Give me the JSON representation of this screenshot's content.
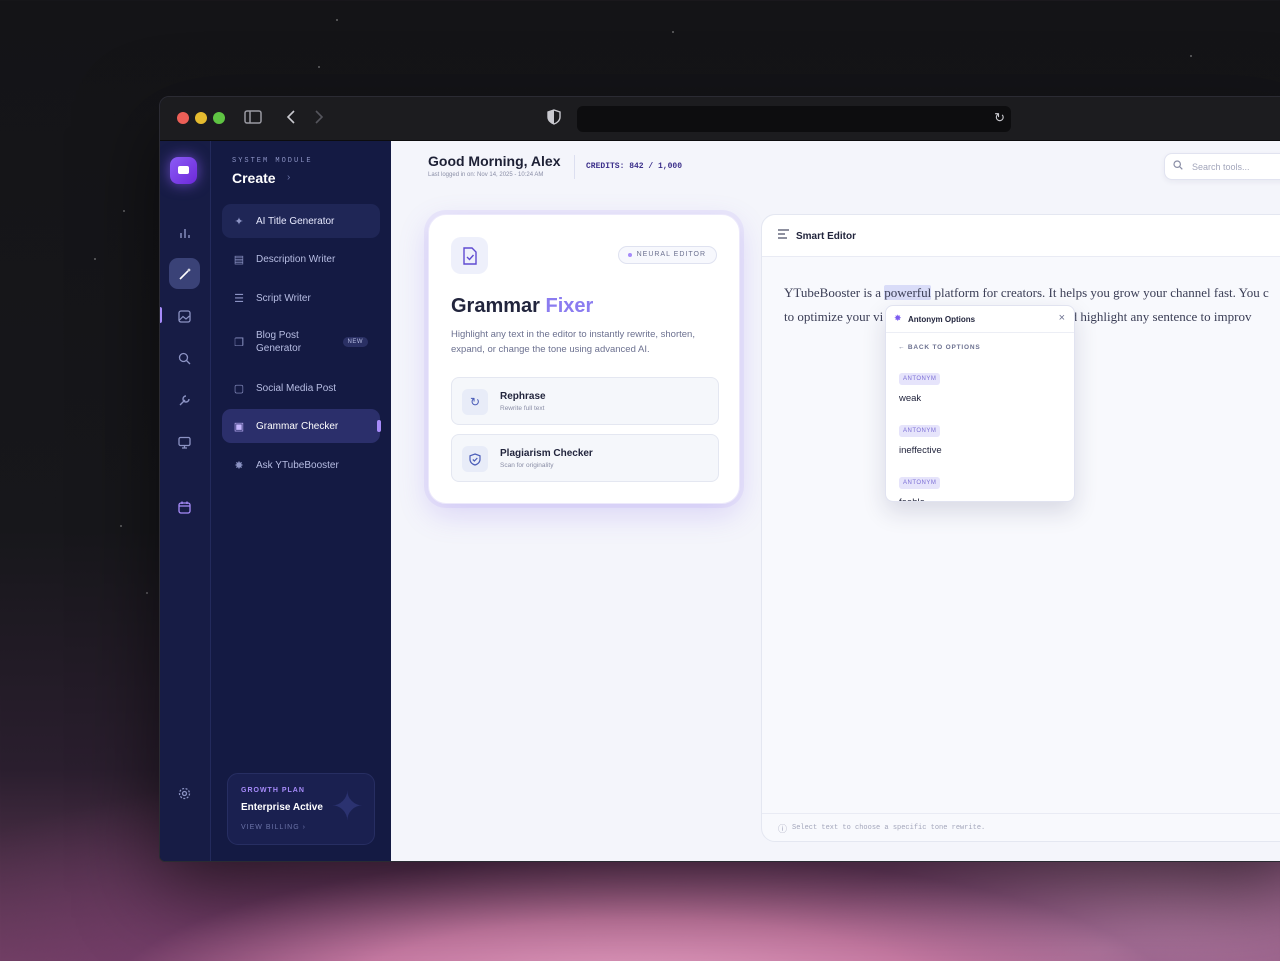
{
  "browser": {
    "url": ""
  },
  "rail": {
    "icons": [
      "bar-chart-icon",
      "magic-wand-icon",
      "image-icon",
      "search-icon",
      "wrench-icon",
      "monitor-icon",
      "calendar-icon",
      "gear-icon"
    ]
  },
  "nav": {
    "kicker": "SYSTEM MODULE",
    "title": "Create",
    "items": [
      {
        "label": "AI Title Generator",
        "icon": "wand-icon"
      },
      {
        "label": "Description Writer",
        "icon": "document-icon"
      },
      {
        "label": "Script Writer",
        "icon": "script-icon"
      },
      {
        "label": "Blog Post Generator",
        "icon": "copy-icon",
        "badge": "NEW"
      },
      {
        "label": "Social Media Post",
        "icon": "chat-icon"
      },
      {
        "label": "Grammar Checker",
        "icon": "doc-check-icon"
      },
      {
        "label": "Ask YTubeBooster",
        "icon": "sparkle-icon"
      }
    ],
    "plan": {
      "kicker": "GROWTH PLAN",
      "title": "Enterprise Active",
      "link": "VIEW BILLING"
    }
  },
  "header": {
    "greeting": "Good Morning, Alex",
    "last_login": "Last logged in on: Nov 14, 2025 - 10:24 AM",
    "credits": "CREDITS: 842 / 1,000",
    "search_placeholder": "Search tools..."
  },
  "tool_card": {
    "chip": "NEURAL EDITOR",
    "title_main": "Grammar",
    "title_accent": "Fixer",
    "description": "Highlight any text in the editor to instantly rewrite, shorten, expand, or change the tone using advanced AI.",
    "options": [
      {
        "title": "Rephrase",
        "subtitle": "Rewrite full text"
      },
      {
        "title": "Plagiarism Checker",
        "subtitle": "Scan for originality"
      }
    ]
  },
  "editor": {
    "title": "Smart Editor",
    "line1_before": "YTubeBooster is a ",
    "line1_highlight": "powerful",
    "line1_after": " platform for creators. It helps you grow your channel fast. You c",
    "line2_before": "to optimize your vi",
    "line2_after": "and highlight any sentence to improv",
    "footer_hint": "Select text to choose a specific tone rewrite."
  },
  "popover": {
    "title": "Antonym Options",
    "back": "BACK TO OPTIONS",
    "tag": "ANTONYM",
    "words": [
      "weak",
      "ineffective",
      "feeble"
    ]
  },
  "colors": {
    "accent": "#8b7cf0",
    "sidebar": "#141a43",
    "rail": "#171c45",
    "main_bg": "#f4f5fb"
  }
}
